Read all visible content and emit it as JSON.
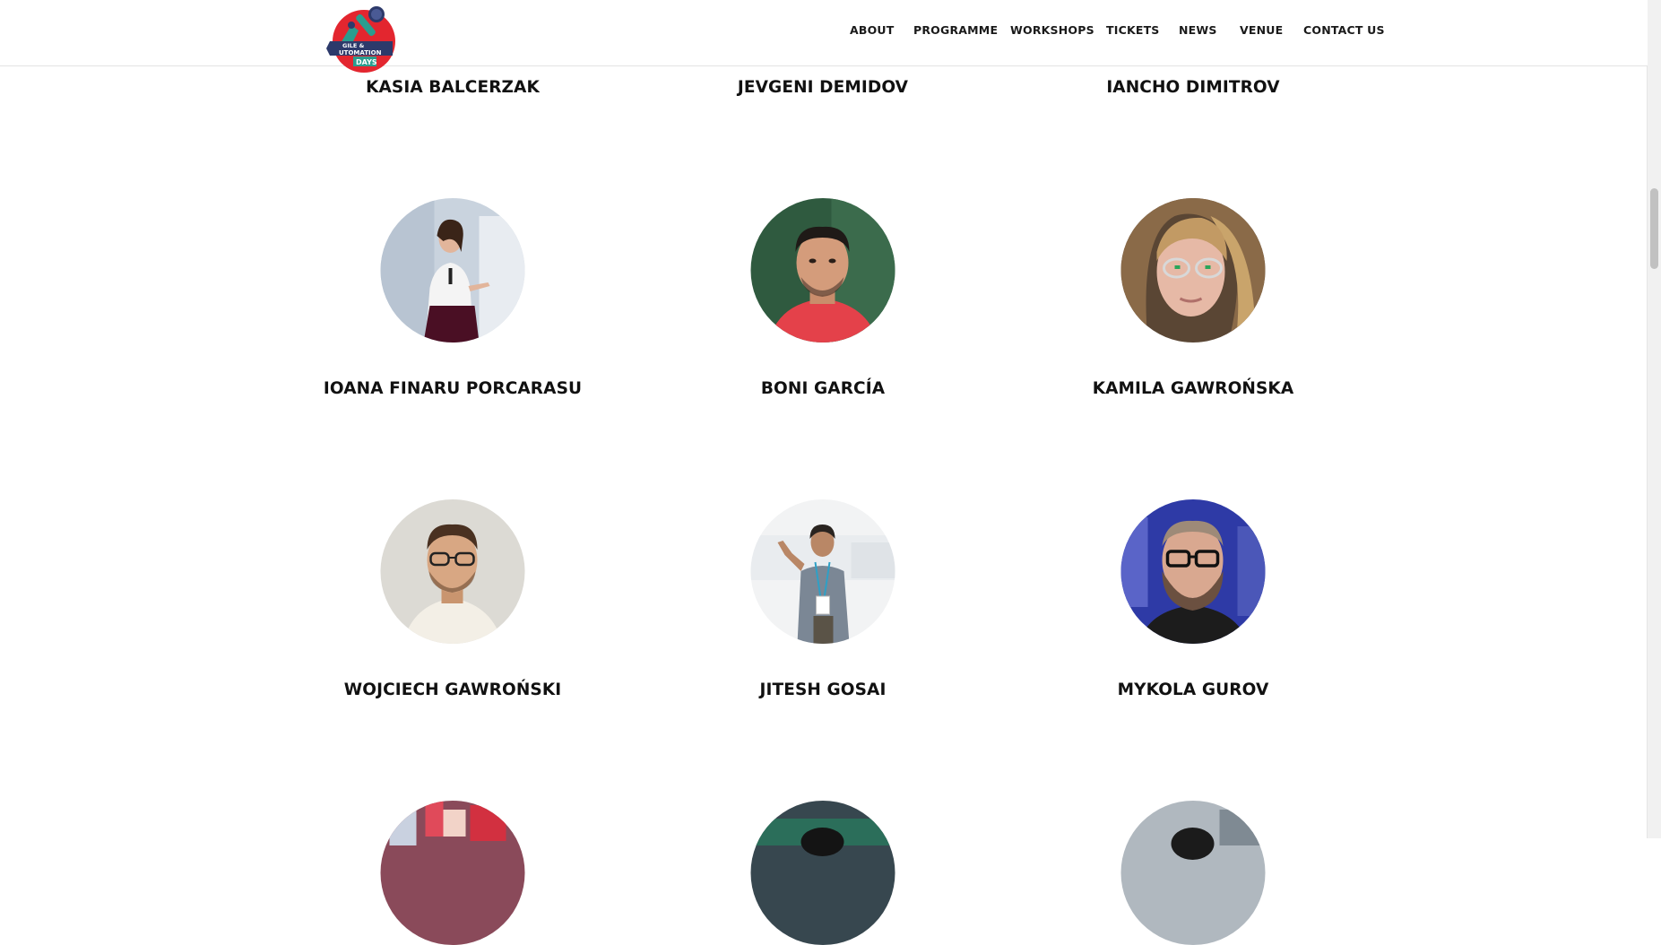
{
  "header": {
    "logo": {
      "alt": "Agile & Automation Days logo",
      "text_line1": "GILE &",
      "text_line2": "UTOMATION",
      "text_line3": "DAYS"
    },
    "nav": [
      {
        "label": "ABOUT"
      },
      {
        "label": "PROGRAMME"
      },
      {
        "label": "WORKSHOPS"
      },
      {
        "label": "TICKETS"
      },
      {
        "label": "NEWS"
      },
      {
        "label": "VENUE"
      },
      {
        "label": "CONTACT US"
      }
    ]
  },
  "speakers": {
    "row0": [
      "KASIA BALCERZAK",
      "JEVGENI DEMIDOV",
      "IANCHO DIMITROV"
    ],
    "row1": [
      "IOANA FINARU PORCARASU",
      "BONI GARCÍA",
      "KAMILA GAWROŃSKA"
    ],
    "row2": [
      "WOJCIECH GAWROŃSKI",
      "JITESH GOSAI",
      "MYKOLA GUROV"
    ]
  },
  "colors": {
    "logo_red": "#e3262f",
    "logo_teal": "#2a9d8f",
    "logo_navy": "#2d3a6b",
    "text": "#111111"
  }
}
